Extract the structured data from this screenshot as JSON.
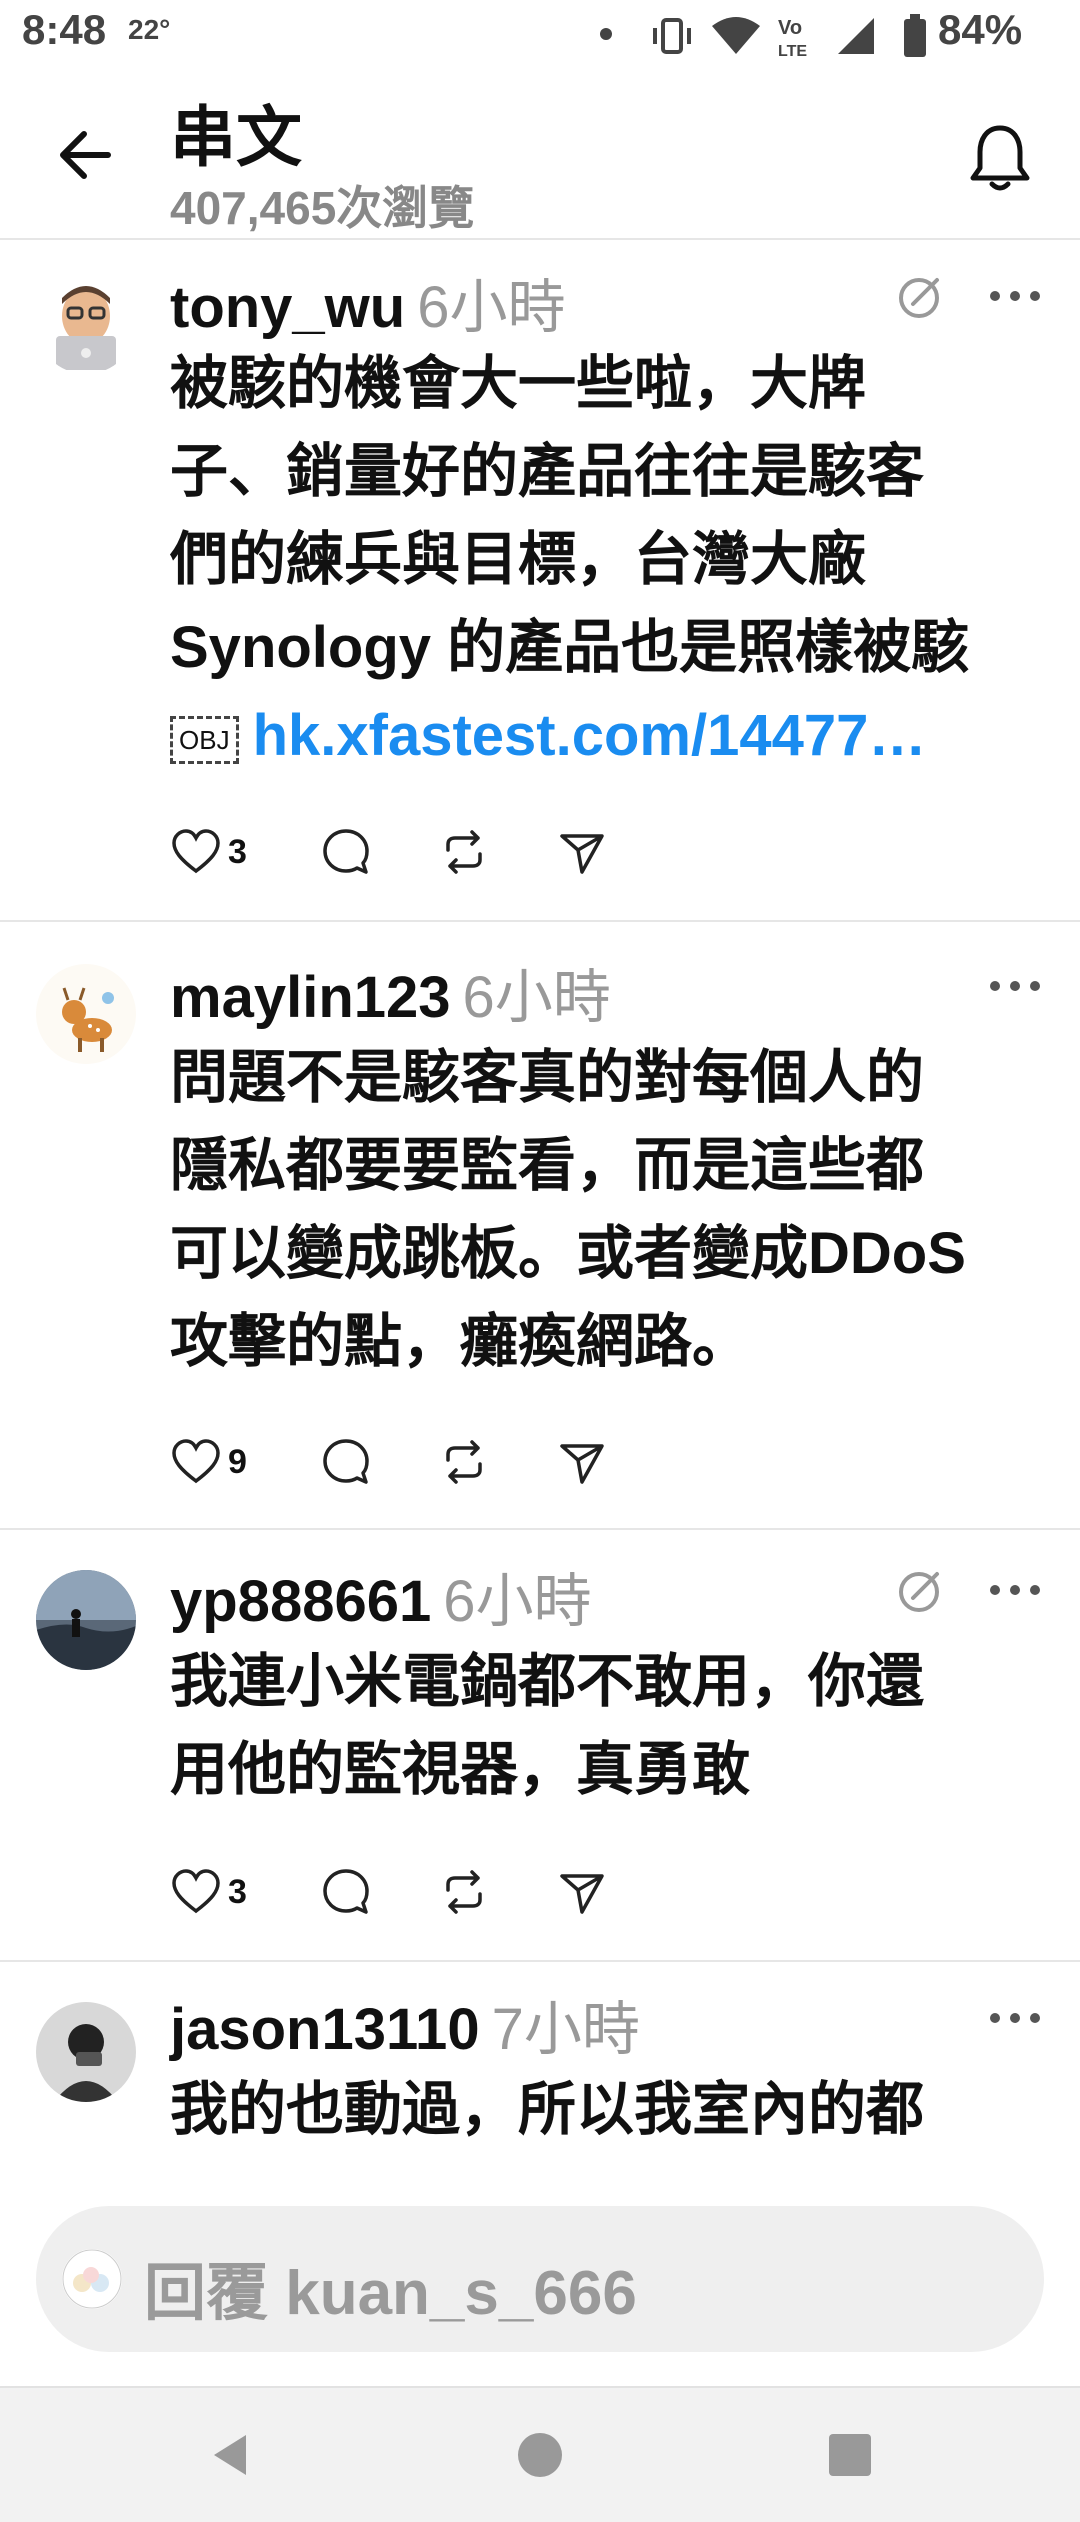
{
  "status": {
    "time": "8:48",
    "temp": "22°",
    "battery": "84%",
    "icons": [
      "vibrate-icon",
      "wifi-icon",
      "volte-icon",
      "signal-icon",
      "battery-icon"
    ]
  },
  "header": {
    "title": "串文",
    "views": "407,465次瀏覽",
    "back_icon": "back-arrow-icon",
    "notify_icon": "bell-icon"
  },
  "posts": [
    {
      "username": "tony_wu",
      "time": "6小時",
      "avatar_icon": "laptop-memoji-avatar",
      "lines": [
        "被駭的機會大一些啦，大牌",
        "子、銷量好的產品往往是駭客",
        "們的練兵與目標，台灣大廠",
        "Synology 的產品也是照樣被駭"
      ],
      "obj_label": "OBJ",
      "link": "hk.xfastest.com/14477…",
      "likes": "3",
      "edited": true
    },
    {
      "username": "maylin123",
      "time": "6小時",
      "avatar_icon": "deer-avatar",
      "lines": [
        "問題不是駭客真的對每個人的",
        "隱私都要要監看，而是這些都",
        "可以變成跳板。或者變成DDoS",
        "攻擊的點，癱瘓網路。"
      ],
      "likes": "9",
      "edited": false
    },
    {
      "username": "yp888661",
      "time": "6小時",
      "avatar_icon": "silhouette-landscape-avatar",
      "lines": [
        "我連小米電鍋都不敢用，你還",
        "用他的監視器，真勇敢"
      ],
      "likes": "3",
      "edited": true
    },
    {
      "username": "jason13110",
      "time": "7小時",
      "avatar_icon": "photo-avatar",
      "lines": [
        "我的也動過，所以我室內的都"
      ],
      "edited": false
    }
  ],
  "reply": {
    "placeholder": "回覆 kuan_s_666"
  },
  "colors": {
    "link": "#1a8cf0",
    "muted": "#999999",
    "text": "#111111"
  }
}
